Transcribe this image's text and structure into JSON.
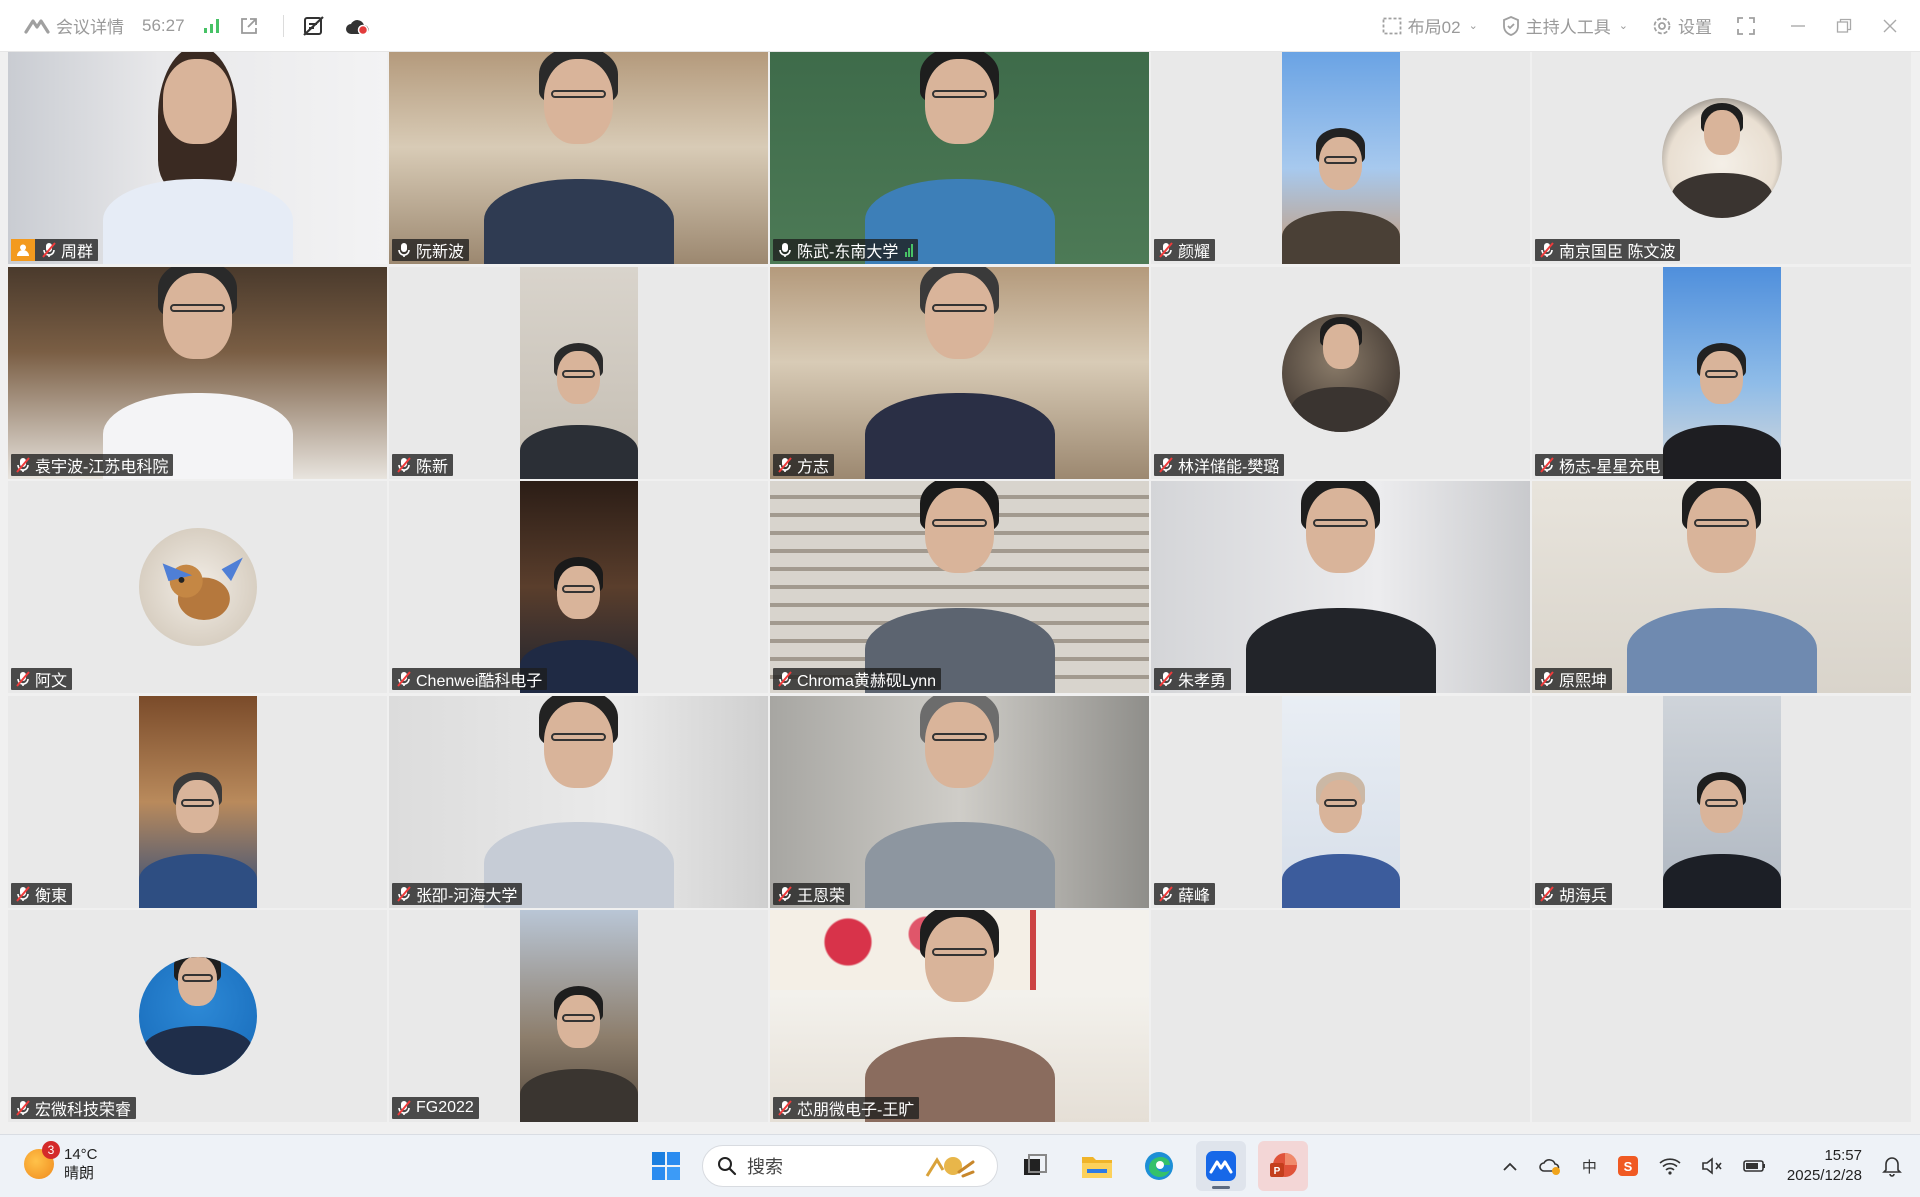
{
  "topbar": {
    "meeting_info_label": "会议详情",
    "timer": "56:27",
    "layout_label": "布局02",
    "host_tools_label": "主持人工具",
    "settings_label": "设置",
    "colors": {
      "accent_green": "#47c266",
      "muted_text": "#9a9a9a"
    }
  },
  "participants": [
    {
      "name": "周群",
      "mic": "muted",
      "host": true
    },
    {
      "name": "阮新波",
      "mic": "on"
    },
    {
      "name": "陈武-东南大学",
      "mic": "on",
      "speaking": true
    },
    {
      "name": "颜耀",
      "mic": "muted"
    },
    {
      "name": "南京国臣  陈文波",
      "mic": "muted"
    },
    {
      "name": "袁宇波-江苏电科院",
      "mic": "muted"
    },
    {
      "name": "陈新",
      "mic": "muted"
    },
    {
      "name": "方志",
      "mic": "muted"
    },
    {
      "name": "林洋储能-樊璐",
      "mic": "muted"
    },
    {
      "name": "杨志-星星充电",
      "mic": "muted"
    },
    {
      "name": "阿文",
      "mic": "muted"
    },
    {
      "name": "Chenwei酷科电子",
      "mic": "muted"
    },
    {
      "name": "Chroma黄赫砚Lynn",
      "mic": "muted"
    },
    {
      "name": "朱孝勇",
      "mic": "muted"
    },
    {
      "name": "原熙坤",
      "mic": "muted"
    },
    {
      "name": "衡東",
      "mic": "muted"
    },
    {
      "name": "张卲-河海大学",
      "mic": "muted"
    },
    {
      "name": "王恩荣",
      "mic": "muted"
    },
    {
      "name": "薛峰",
      "mic": "muted"
    },
    {
      "name": "胡海兵",
      "mic": "muted"
    },
    {
      "name": "宏微科技荣睿",
      "mic": "muted"
    },
    {
      "name": "FG2022",
      "mic": "muted"
    },
    {
      "name": "芯朋微电子-王旷",
      "mic": "muted"
    }
  ],
  "taskbar": {
    "weather_temp": "14°C",
    "weather_desc": "晴朗",
    "weather_badge": "3",
    "search_placeholder": "搜索",
    "time": "15:57",
    "date": "2025/12/28",
    "tray_ime": "中"
  }
}
